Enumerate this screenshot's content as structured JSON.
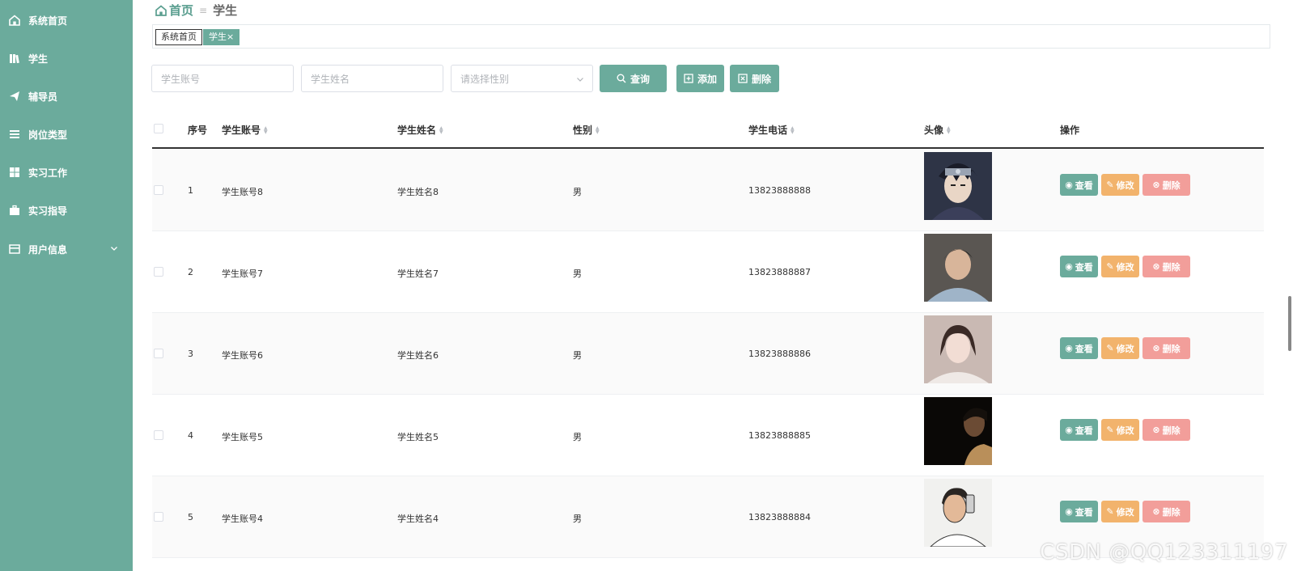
{
  "sidebar": {
    "items": [
      {
        "label": "系统首页",
        "icon": "home-icon"
      },
      {
        "label": "学生",
        "icon": "books-icon"
      },
      {
        "label": "辅导员",
        "icon": "paper-plane-icon"
      },
      {
        "label": "岗位类型",
        "icon": "list-icon"
      },
      {
        "label": "实习工作",
        "icon": "grid-icon"
      },
      {
        "label": "实习指导",
        "icon": "briefcase-icon"
      },
      {
        "label": "用户信息",
        "icon": "card-icon"
      }
    ]
  },
  "breadcrumb": {
    "home": "首页",
    "sep": "≡",
    "current": "学生"
  },
  "tabs": [
    {
      "label": "系统首页"
    },
    {
      "label": "学生×"
    }
  ],
  "filters": {
    "account_placeholder": "学生账号",
    "name_placeholder": "学生姓名",
    "gender_placeholder": "请选择性别"
  },
  "buttons": {
    "search": "查询",
    "add": "添加",
    "delete": "删除"
  },
  "table": {
    "headers": [
      "序号",
      "学生账号",
      "学生姓名",
      "性别",
      "学生电话",
      "头像",
      "操作"
    ],
    "rows": [
      {
        "index": "1",
        "account": "学生账号8",
        "name": "学生姓名8",
        "gender": "男",
        "phone": "13823888888"
      },
      {
        "index": "2",
        "account": "学生账号7",
        "name": "学生姓名7",
        "gender": "男",
        "phone": "13823888887"
      },
      {
        "index": "3",
        "account": "学生账号6",
        "name": "学生姓名6",
        "gender": "男",
        "phone": "13823888886"
      },
      {
        "index": "4",
        "account": "学生账号5",
        "name": "学生姓名5",
        "gender": "男",
        "phone": "13823888885"
      },
      {
        "index": "5",
        "account": "学生账号4",
        "name": "学生姓名4",
        "gender": "男",
        "phone": "13823888884"
      }
    ],
    "actions": {
      "view": "查看",
      "edit": "修改",
      "delete": "删除"
    }
  },
  "watermark": "CSDN @QQ123311197",
  "colors": {
    "primary": "#6bab9c",
    "warning": "#f2b36c",
    "danger": "#f29e9a"
  }
}
